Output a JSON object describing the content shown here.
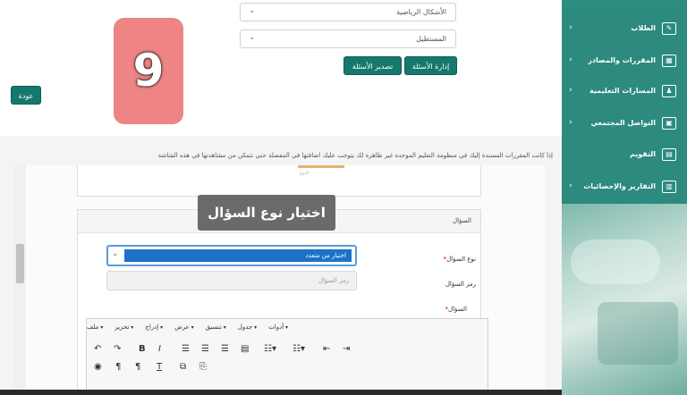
{
  "top": {
    "select1": "الأشكال الرياضية",
    "select2": "المستطيل",
    "btn_manage": "إدارة الأسئلة",
    "btn_export": "تصدير الأسئلة",
    "btn_back": "عودة",
    "badge_number": "9"
  },
  "notice": "إذا كانت المقررات المسندة إليك في منظومة التعليم الموحدة غير ظاهرة لك يتوجب عليك اضافتها في المفضلة حتى تتمكن من مشاهدتها في هذه الشاشة",
  "tooltip": "اختيار نوع السؤال",
  "panel": {
    "title": "السؤال",
    "field_type_label": "نوع السؤال",
    "field_type_value": "اختيار من متعدد",
    "field_code_label": "رمز السؤال",
    "field_code_placeholder": "رمز السؤال",
    "field_question_label": "السؤال",
    "required_mark": "*",
    "upper_box_label": "النوع"
  },
  "editor": {
    "menus": [
      "ملف",
      "تحرير",
      "إدراج",
      "عرض",
      "تنسيق",
      "جدول",
      "أدوات"
    ]
  },
  "sidebar": {
    "items": [
      {
        "label": "الطلاب"
      },
      {
        "label": "المقررات والمصادر"
      },
      {
        "label": "المسارات التعليمية"
      },
      {
        "label": "التواصل المجتمعي"
      },
      {
        "label": "التقويم"
      },
      {
        "label": "التقارير والإحصائيات"
      }
    ],
    "accent_color": "#2c8a7e"
  },
  "colors": {
    "primary_button": "#15786c",
    "badge": "#ee8484",
    "selected_option": "#1a73c9"
  }
}
